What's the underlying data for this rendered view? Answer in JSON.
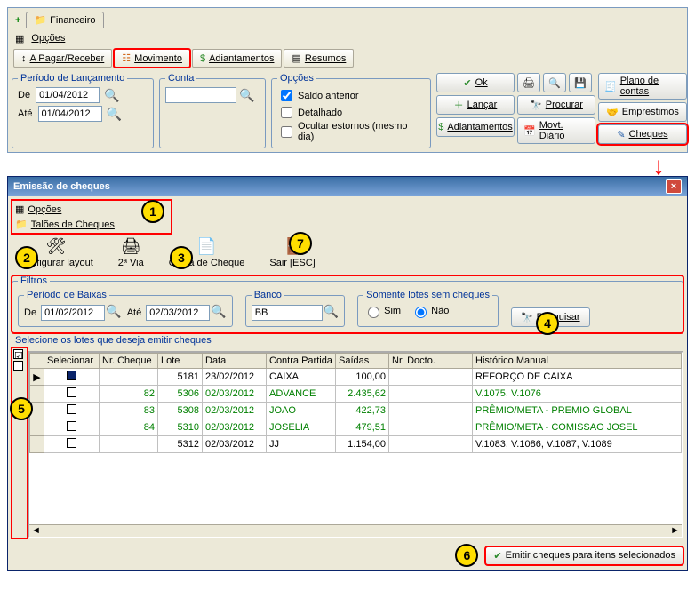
{
  "top_tab": "Financeiro",
  "menu_opcoes": "Opções",
  "toolbar": {
    "apagar": "A Pagar/Receber",
    "movimento": "Movimento",
    "adiant": "Adiantamentos",
    "resumos": "Resumos"
  },
  "periodo_group": "Período de Lançamento",
  "de": "De",
  "ate": "Até",
  "date_de": "01/04/2012",
  "date_ate": "01/04/2012",
  "conta_group": "Conta",
  "conta_val": "",
  "opcoes_group": "Opções",
  "chk_saldo": "Saldo anterior",
  "chk_det": "Detalhado",
  "chk_ocult": "Ocultar estornos (mesmo dia)",
  "btns": {
    "ok": "Ok",
    "lancar": "Lançar",
    "adiant": "Adiantamentos",
    "procurar": "Procurar",
    "movdiario": "Movt. Diário",
    "plano": "Plano de contas",
    "emprest": "Emprestimos",
    "cheques": "Cheques"
  },
  "dialog_title": "Emissão de cheques",
  "dlg_opcoes": "Opções",
  "dlg_taloes": "Talões de Cheques",
  "tools": {
    "config": "Configurar layout",
    "via2": "2ª Via",
    "copia": "Cópia de Cheque",
    "sair": "Sair [ESC]"
  },
  "filtros": "Filtros",
  "periodo_baixas": "Período de Baixas",
  "fil_de": "01/02/2012",
  "fil_ate": "02/03/2012",
  "banco_lbl": "Banco",
  "banco_val": "BB",
  "lotes_sem": "Somente lotes sem cheques",
  "sim": "Sim",
  "nao": "Não",
  "pesquisar": "Pesquisar",
  "grid_title": "Selecione os lotes que deseja emitir cheques",
  "cols": {
    "sel": "Selecionar",
    "nrc": "Nr. Cheque",
    "lote": "Lote",
    "data": "Data",
    "cp": "Contra Partida",
    "saidas": "Saídas",
    "doc": "Nr. Docto.",
    "hist": "Histórico Manual"
  },
  "rows": [
    {
      "nrc": "",
      "lote": "5181",
      "data": "23/02/2012",
      "cp": "CAIXA",
      "saidas": "100,00",
      "doc": "",
      "hist": "REFORÇO DE CAIXA",
      "green": false,
      "first": true
    },
    {
      "nrc": "82",
      "lote": "5306",
      "data": "02/03/2012",
      "cp": "ADVANCE",
      "saidas": "2.435,62",
      "doc": "",
      "hist": "V.1075, V.1076",
      "green": true
    },
    {
      "nrc": "83",
      "lote": "5308",
      "data": "02/03/2012",
      "cp": "JOAO",
      "saidas": "422,73",
      "doc": "",
      "hist": "PRÊMIO/META - PREMIO GLOBAL",
      "green": true
    },
    {
      "nrc": "84",
      "lote": "5310",
      "data": "02/03/2012",
      "cp": "JOSELIA",
      "saidas": "479,51",
      "doc": "",
      "hist": "PRÊMIO/META - COMISSAO JOSEL",
      "green": true
    },
    {
      "nrc": "",
      "lote": "5312",
      "data": "02/03/2012",
      "cp": "JJ",
      "saidas": "1.154,00",
      "doc": "",
      "hist": "V.1083, V.1086, V.1087, V.1089",
      "green": false
    }
  ],
  "emit": "Emitir cheques para itens selecionados"
}
